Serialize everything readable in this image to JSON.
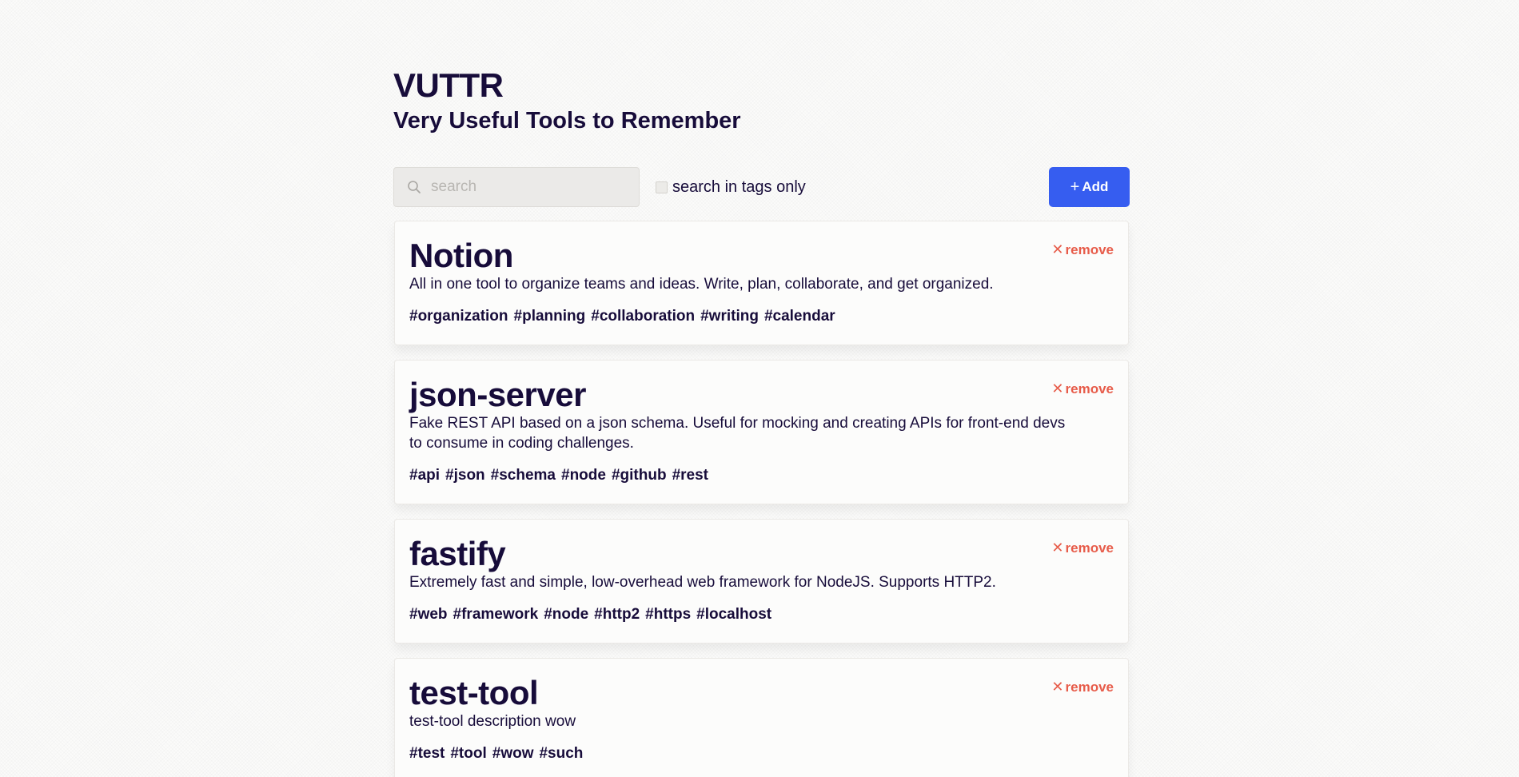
{
  "header": {
    "title": "VUTTR",
    "subtitle": "Very Useful Tools to Remember"
  },
  "toolbar": {
    "search_placeholder": "search",
    "search_value": "",
    "tags_only_label": "search in tags only",
    "tags_only_checked": false,
    "add_label": "Add",
    "add_icon": "+"
  },
  "tools": [
    {
      "name": "Notion",
      "description": "All in one tool to organize teams and ideas. Write, plan, collaborate, and get organized.",
      "tags": [
        "#organization",
        "#planning",
        "#collaboration",
        "#writing",
        "#calendar"
      ],
      "remove_label": "remove"
    },
    {
      "name": "json-server",
      "description": "Fake REST API based on a json schema. Useful for mocking and creating APIs for front-end devs to consume in coding challenges.",
      "tags": [
        "#api",
        "#json",
        "#schema",
        "#node",
        "#github",
        "#rest"
      ],
      "remove_label": "remove"
    },
    {
      "name": "fastify",
      "description": "Extremely fast and simple, low-overhead web framework for NodeJS. Supports HTTP2.",
      "tags": [
        "#web",
        "#framework",
        "#node",
        "#http2",
        "#https",
        "#localhost"
      ],
      "remove_label": "remove"
    },
    {
      "name": "test-tool",
      "description": "test-tool description wow",
      "tags": [
        "#test",
        "#tool",
        "#wow",
        "#such"
      ],
      "remove_label": "remove"
    }
  ],
  "colors": {
    "primary": "#365df0",
    "danger": "#e75c4a",
    "ink": "#170c3a",
    "background": "#fbfbfa"
  }
}
